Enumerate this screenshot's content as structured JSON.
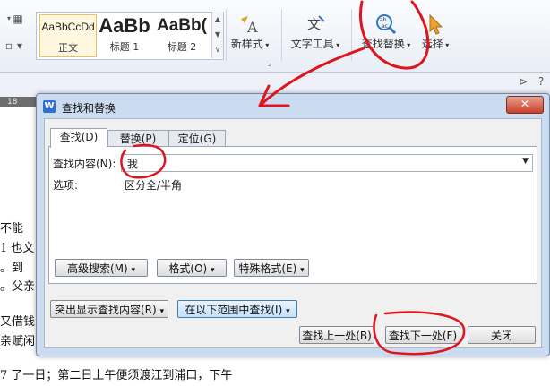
{
  "ribbon": {
    "styles": [
      {
        "sample": "AaBbCcDd",
        "name": "正文"
      },
      {
        "sample": "AaBb",
        "name": "标题 1"
      },
      {
        "sample": "AaBb(",
        "name": "标题 2"
      }
    ],
    "new_style_label": "新样式",
    "text_tools_label": "文字工具",
    "find_replace_label": "查找替换",
    "select_label": "选择"
  },
  "ruler": {
    "number": "18"
  },
  "document": {
    "fragments": [
      "不能",
      "1 也文",
      "。到",
      "。父亲",
      "又借钱",
      "亲赋闲",
      "7 了一日；第二日上午便须渡江到浦口，下午"
    ]
  },
  "dialog": {
    "title": "查找和替换",
    "close_label": "✕",
    "tabs": [
      {
        "label": "查找(D)",
        "active": true
      },
      {
        "label": "替换(P)",
        "active": false
      },
      {
        "label": "定位(G)",
        "active": false
      }
    ],
    "find_label": "查找内容(N):",
    "find_value": "我",
    "options_label": "选项:",
    "options_value": "区分全/半角",
    "buttons": {
      "advanced_search": "高级搜索(M)",
      "format": "格式(O)",
      "special_format": "特殊格式(E)",
      "highlight": "突出显示查找内容(R)",
      "find_in": "在以下范围中查找(I)",
      "find_prev": "查找上一处(B)",
      "find_next": "查找下一处(F)",
      "close": "关闭"
    }
  },
  "colors": {
    "annotation": "#e0141c",
    "accent": "#2f6fd0"
  }
}
